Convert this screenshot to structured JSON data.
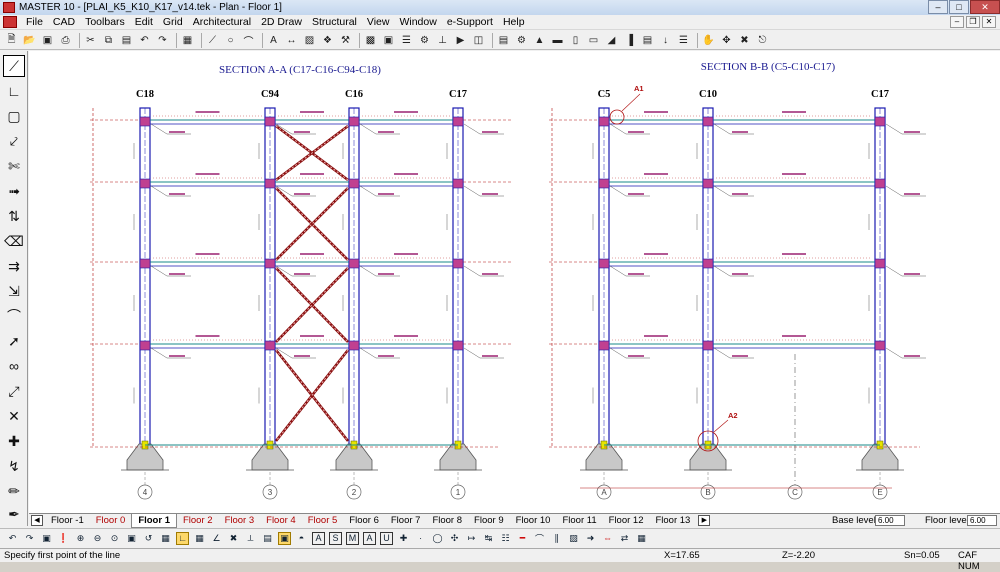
{
  "window": {
    "title": "MASTER 10 - [PLAI_K5_K10_K17_v14.tek - Plan - Floor 1]"
  },
  "menu": [
    "File",
    "CAD",
    "Toolbars",
    "Edit",
    "Grid",
    "Architectural",
    "2D Draw",
    "Structural",
    "View",
    "Window",
    "e-Support",
    "Help"
  ],
  "toolbar_icons": [
    "new-icon",
    "open-icon",
    "save-icon",
    "print-icon",
    "cut-icon",
    "copy-icon",
    "paste-icon",
    "undo-icon",
    "redo-icon",
    "grid-icon",
    "line-icon",
    "circle-icon",
    "arc-icon",
    "text-icon",
    "dimension-icon",
    "hatch-icon",
    "symbol-icon",
    "tools-icon",
    "zoom-window-icon",
    "zoom-all-icon",
    "layers-icon",
    "properties-icon",
    "measure-icon",
    "select-icon",
    "calc-icon",
    "report-icon",
    "settings-icon",
    "hand-icon",
    "pan-icon",
    "delete-icon",
    "close-icon"
  ],
  "left_tools": [
    "draw-line-tool",
    "polyline-tool",
    "rectangle-tool",
    "move-tool",
    "trim-tool",
    "dimension-tool",
    "mirror-tool",
    "erase-tool",
    "offset-tool",
    "stretch-tool",
    "fillet-tool",
    "extend-tool",
    "break-tool",
    "scale-tool",
    "rotate-tool",
    "snap-tool",
    "join-tool",
    "color-picker-tool",
    "pen-tool"
  ],
  "drawing": {
    "section_a": {
      "title": "SECTION A-A (C17-C16-C94-C18)",
      "columns": [
        "C18",
        "C94",
        "C16",
        "C17"
      ],
      "axes": [
        "4",
        "3",
        "2",
        "1"
      ]
    },
    "section_b": {
      "title": "SECTION B-B (C5-C10-C17)",
      "columns": [
        "C5",
        "C10",
        "C17"
      ],
      "axes": [
        "A",
        "B",
        "C",
        "E"
      ],
      "markers": [
        "A1",
        "A2"
      ]
    },
    "colors": {
      "column": "#1a1ab0",
      "beam_top": "#1a8a8a",
      "label": "#9a2070",
      "dim": "#b01010",
      "brace": "#8b1010",
      "footing": "#c8c8c8"
    }
  },
  "floor_tabs": [
    "Floor -1",
    "Floor 0",
    "Floor 1",
    "Floor 2",
    "Floor 3",
    "Floor 4",
    "Floor 5",
    "Floor 6",
    "Floor 7",
    "Floor 8",
    "Floor 9",
    "Floor 10",
    "Floor 11",
    "Floor 12",
    "Floor 13"
  ],
  "active_floor": "Floor 1",
  "base_level": {
    "label": "Base level:",
    "value": "6.00"
  },
  "floor_level": {
    "label": "Floor level:",
    "value": "6.00"
  },
  "status": {
    "prompt": "Specify first point of the line",
    "x": "X=17.65",
    "z": "Z=-2.20",
    "sn": "Sn=0.05",
    "flags": "CAF  NUM"
  }
}
